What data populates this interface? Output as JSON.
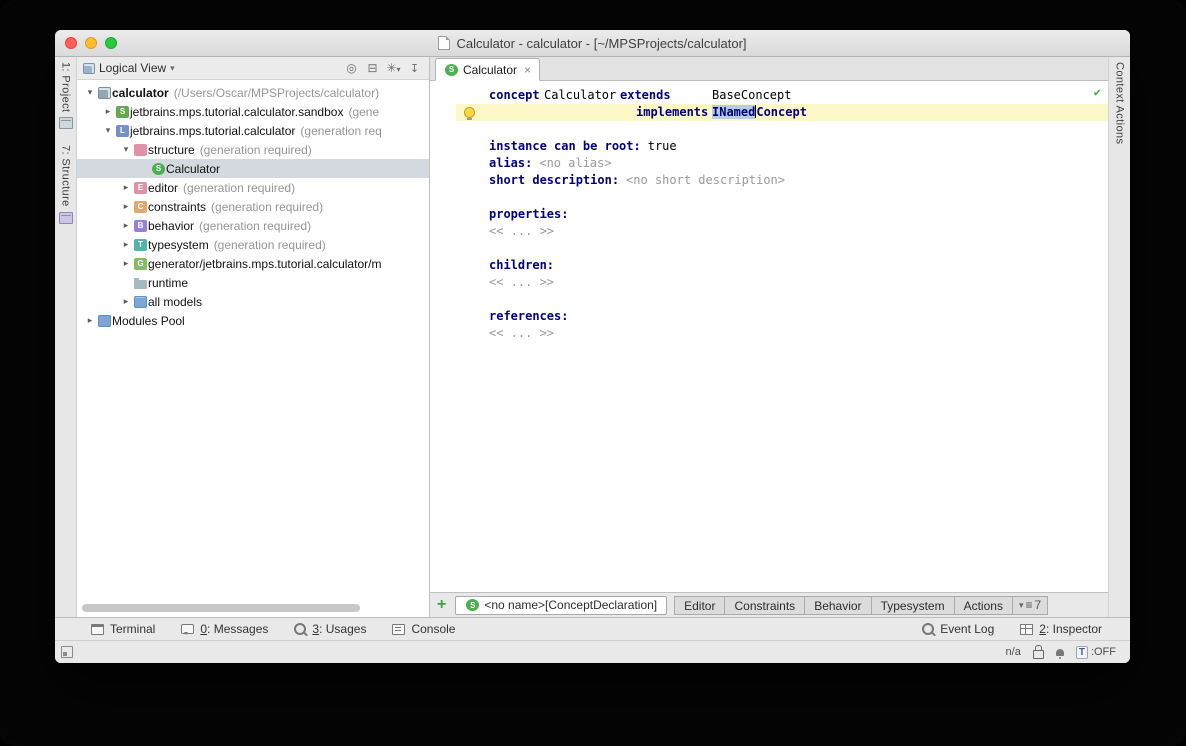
{
  "window": {
    "title": "Calculator - calculator - [~/MPSProjects/calculator]"
  },
  "tool_stripes": {
    "project": "1: Project",
    "structure": "7: Structure",
    "context_actions": "Context Actions"
  },
  "project_panel": {
    "view_selector": "Logical View",
    "tree": [
      {
        "label": "calculator",
        "detail": "(/Users/Oscar/MPSProjects/calculator)",
        "icon": "project",
        "level": 0,
        "arrow": "expanded",
        "bold": true,
        "selected": false
      },
      {
        "label": "jetbrains.mps.tutorial.calculator.sandbox",
        "detail": "(gene",
        "icon": "sandbox-s",
        "level": 1,
        "arrow": "collapsed",
        "bold": false,
        "selected": false
      },
      {
        "label": "jetbrains.mps.tutorial.calculator",
        "detail": "(generation req",
        "icon": "language-l",
        "level": 1,
        "arrow": "expanded",
        "bold": false,
        "selected": false
      },
      {
        "label": "structure",
        "detail": "(generation required)",
        "icon": "model",
        "level": 2,
        "arrow": "expanded",
        "bold": false,
        "selected": false
      },
      {
        "label": "Calculator",
        "detail": "",
        "icon": "concept-s",
        "level": 3,
        "arrow": "none",
        "bold": false,
        "selected": true
      },
      {
        "label": "editor",
        "detail": "(generation required)",
        "icon": "model-e",
        "level": 2,
        "arrow": "collapsed",
        "bold": false,
        "selected": false
      },
      {
        "label": "constraints",
        "detail": "(generation required)",
        "icon": "model-c",
        "level": 2,
        "arrow": "collapsed",
        "bold": false,
        "selected": false
      },
      {
        "label": "behavior",
        "detail": "(generation required)",
        "icon": "model-b",
        "level": 2,
        "arrow": "collapsed",
        "bold": false,
        "selected": false
      },
      {
        "label": "typesystem",
        "detail": "(generation required)",
        "icon": "model-t",
        "level": 2,
        "arrow": "collapsed",
        "bold": false,
        "selected": false
      },
      {
        "label": "generator/jetbrains.mps.tutorial.calculator/m",
        "detail": "",
        "icon": "model-g",
        "level": 2,
        "arrow": "collapsed",
        "bold": false,
        "selected": false
      },
      {
        "label": "runtime",
        "detail": "",
        "icon": "folder",
        "level": 2,
        "arrow": "none",
        "bold": false,
        "selected": false
      },
      {
        "label": "all models",
        "detail": "",
        "icon": "models",
        "level": 2,
        "arrow": "collapsed",
        "bold": false,
        "selected": false
      },
      {
        "label": "Modules Pool",
        "detail": "",
        "icon": "modules-pool",
        "level": 0,
        "arrow": "collapsed",
        "bold": false,
        "selected": false
      }
    ]
  },
  "editor": {
    "tab_label": "Calculator",
    "code": {
      "kw_concept": "concept",
      "concept_name": "Calculator",
      "kw_extends": "extends",
      "extends_value": "BaseConcept",
      "kw_implements": "implements",
      "implements_selected": "INamed",
      "implements_rest": "Concept",
      "kw_instance_root": "instance can be root:",
      "instance_root_value": "true",
      "kw_alias": "alias:",
      "alias_value": "<no alias>",
      "kw_short_description": "short description:",
      "short_description_value": "<no short description>",
      "kw_properties": "properties:",
      "kw_children": "children:",
      "kw_references": "references:",
      "empty_list": "<< ... >>"
    },
    "node_tabs": {
      "current_node": "<no name>[ConceptDeclaration]",
      "aspects": [
        "Editor",
        "Constraints",
        "Behavior",
        "Typesystem",
        "Actions"
      ],
      "hidden_count": "7"
    }
  },
  "status_bar": {
    "terminal": "Terminal",
    "messages_mnemonic": "0",
    "messages_rest": ": Messages",
    "usages_mnemonic": "3",
    "usages_rest": ": Usages",
    "console": "Console",
    "event_log": "Event Log",
    "inspector_mnemonic": "2",
    "inspector_rest": ": Inspector"
  },
  "bottom_bar": {
    "position": "n/a",
    "toggle_letter": "T",
    "toggle_state": ":OFF"
  },
  "colors": {
    "keyword": "#000080",
    "placeholder": "#9a9a9a",
    "line_highlight": "#fbf7c6",
    "selection": "#b7cce6",
    "selected_tree_row": "#d3d9de",
    "concept_icon_green": "#4caf50"
  }
}
